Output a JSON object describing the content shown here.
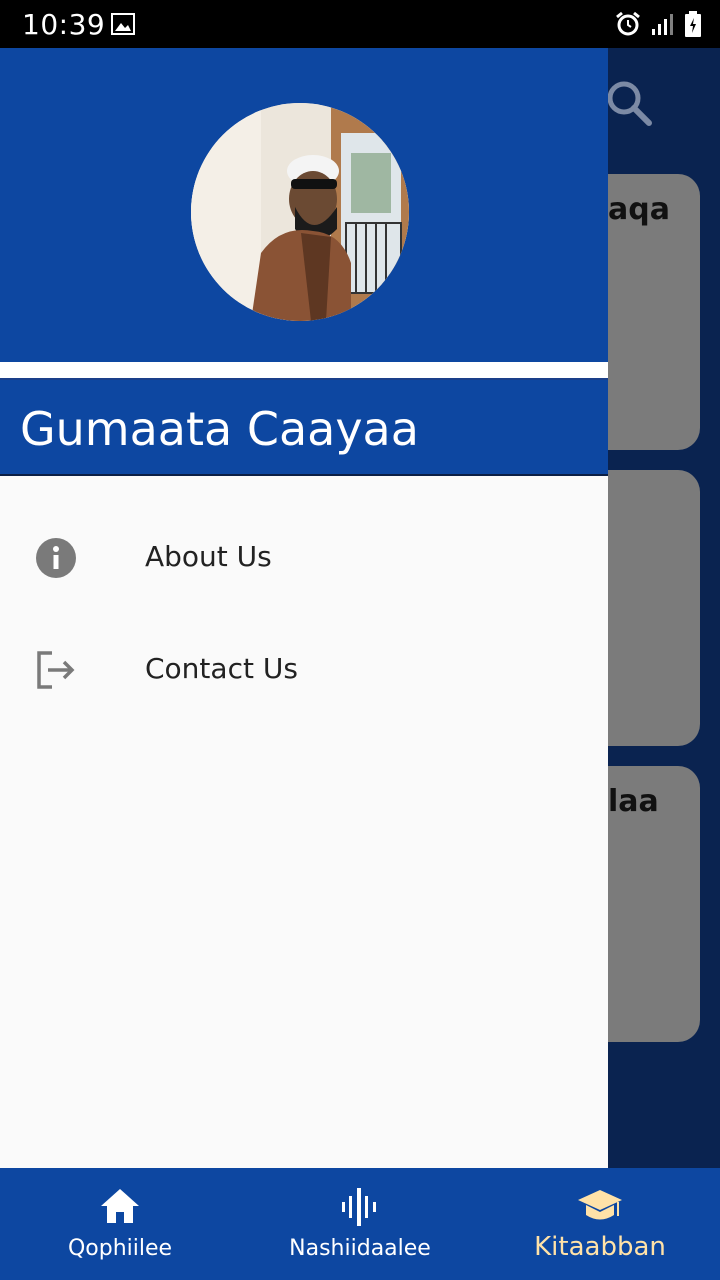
{
  "status_bar": {
    "time": "10:39"
  },
  "background_cards": [
    {
      "title": "aqa"
    },
    {
      "title": ""
    },
    {
      "title": "laa"
    }
  ],
  "drawer": {
    "title": "Gumaata Caayaa",
    "menu": [
      {
        "label": "About Us",
        "icon": "info-icon"
      },
      {
        "label": "Contact Us",
        "icon": "logout-icon"
      }
    ]
  },
  "bottom_nav": {
    "items": [
      {
        "label": "Qophiilee",
        "icon": "home-icon"
      },
      {
        "label": "Nashiidaalee",
        "icon": "audio-wave-icon"
      },
      {
        "label": "Kitaabban",
        "icon": "graduation-cap-icon",
        "active": true
      }
    ],
    "active_color": "#ffe2a8"
  },
  "colors": {
    "primary": "#0d47a1",
    "scrim": "#0a2350",
    "drawer_bg": "#fafafa"
  }
}
